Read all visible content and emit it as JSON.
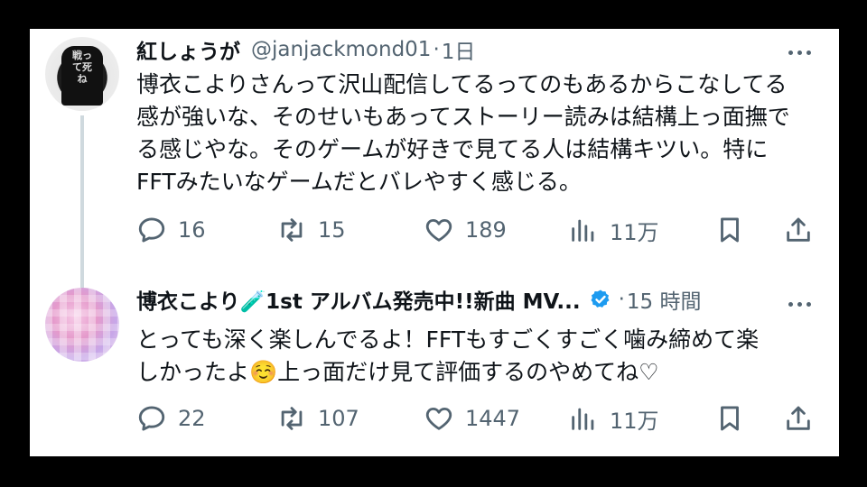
{
  "tweets": [
    {
      "avatar_text": "戦って死ね",
      "name": "紅しょうが",
      "handle": "@janjackmond01",
      "separator": "·",
      "time": "1日",
      "text_lines": [
        "博衣こよりさんって沢山配信してるってのもあるからこなしてる",
        "感が強いな、そのせいもあってストーリー読みは結構上っ面撫で",
        "る感じやな。そのゲームが好きで見てる人は結構キツい。特に",
        "FFTみたいなゲームだとバレやすく感じる。"
      ],
      "replies": "16",
      "retweets": "15",
      "likes": "189",
      "views": "11万",
      "icons": [
        "reply-icon",
        "retweet-icon",
        "like-icon",
        "views-icon",
        "bookmark-icon",
        "share-icon",
        "more-icon"
      ]
    },
    {
      "name": "博衣こより🧪1st アルバム発売中!!新曲 MV...",
      "separator": "·",
      "time": "15 時間",
      "verified_color": "#1d9bf0",
      "text_lines": [
        "とっても深く楽しんでるよ！FFTもすごくすごく噛み締めて楽",
        "しかったよ☺️上っ面だけ見て評価するのやめてね♡"
      ],
      "replies": "22",
      "retweets": "107",
      "likes": "1447",
      "views": "11万",
      "icons": [
        "reply-icon",
        "retweet-icon",
        "like-icon",
        "views-icon",
        "bookmark-icon",
        "share-icon",
        "more-icon"
      ]
    }
  ]
}
